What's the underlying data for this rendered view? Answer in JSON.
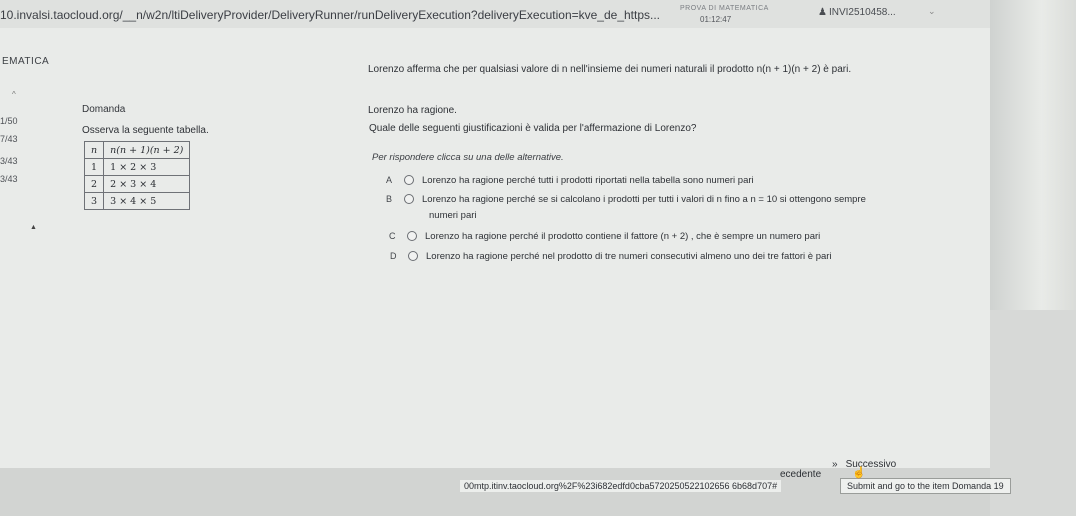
{
  "browser": {
    "url": "10.invalsi.taocloud.org/__n/w2n/ltiDeliveryProvider/DeliveryRunner/runDeliveryExecution?deliveryExecution=kve_de_https..."
  },
  "header": {
    "test_name": "PROVA DI MATEMATICA",
    "timer": "01:12:47",
    "user": "INVI2510458...",
    "user_icon": "user-icon",
    "caret_icon": "chevron-down-icon"
  },
  "sidebar": {
    "subject": "EMATICA",
    "progress": [
      "1/50",
      "7/43",
      "3/43",
      "3/43"
    ]
  },
  "question": {
    "title": "Domanda",
    "instruction": "Osserva la seguente tabella.",
    "statement": "Lorenzo afferma che per qualsiasi valore di n nell'insieme dei numeri naturali il prodotto n(n + 1)(n + 2) è pari.",
    "statement_repeat": "Lorenzo ha ragione.",
    "ask": "Quale delle seguenti giustificazioni è valida per l'affermazione di Lorenzo?",
    "hint": "Per rispondere clicca su una delle alternative."
  },
  "table": {
    "headers": [
      "n",
      "n(n + 1)(n + 2)"
    ],
    "rows": [
      [
        "1",
        "1 × 2 × 3"
      ],
      [
        "2",
        "2 × 3 × 4"
      ],
      [
        "3",
        "3 × 4 × 5"
      ]
    ]
  },
  "options": [
    {
      "letter": "A",
      "text": "Lorenzo ha ragione perché tutti i prodotti riportati nella tabella sono numeri pari"
    },
    {
      "letter": "B",
      "text": "Lorenzo ha ragione perché se si calcolano i prodotti per tutti i valori di n fino a n = 10 si ottengono sempre",
      "text_cont": "numeri pari"
    },
    {
      "letter": "C",
      "text": "Lorenzo ha ragione perché il prodotto contiene il fattore (n + 2) , che è sempre un numero pari"
    },
    {
      "letter": "D",
      "text": "Lorenzo ha ragione perché nel prodotto di tre numeri consecutivi almeno uno dei tre fattori è pari"
    }
  ],
  "footer": {
    "status_url": "00mtp.itinv.taocloud.org%2F%23i682edfd0cba5720250522102656 6b68d707#",
    "prev_label": "ecedente",
    "next_label": "Successivo",
    "next_icon": "double-chevron-right-icon",
    "submit_tooltip": "Submit and go to the item Domanda 19"
  }
}
